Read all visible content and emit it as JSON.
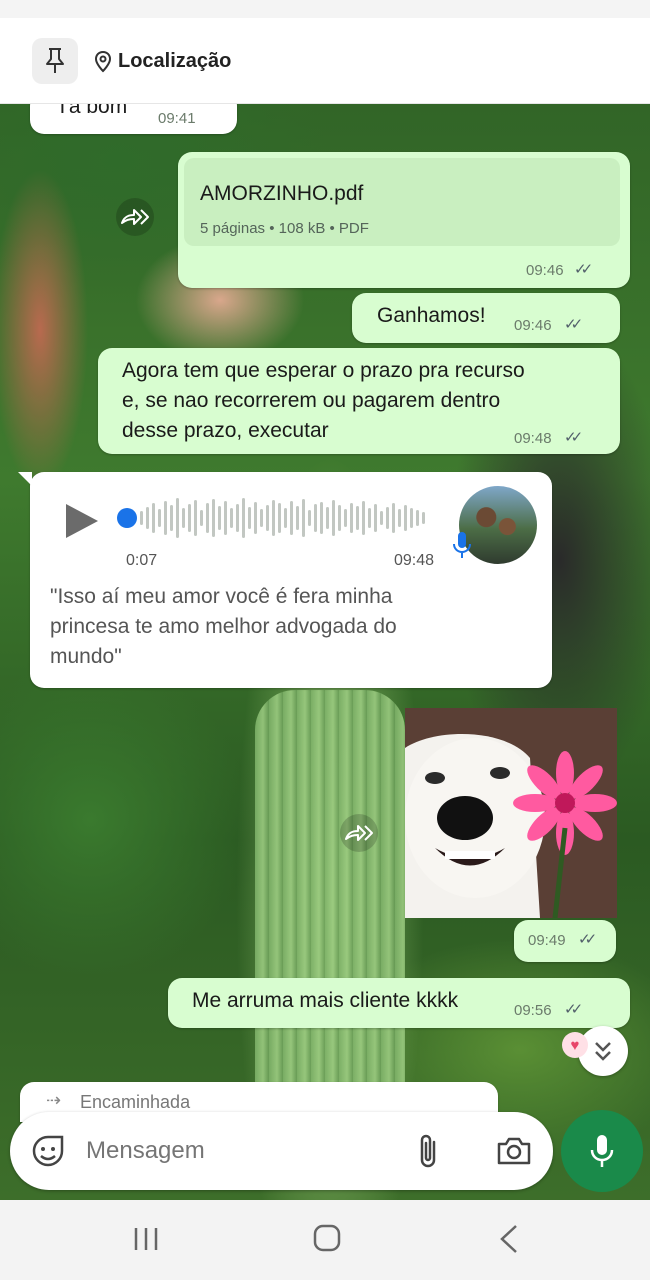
{
  "header": {
    "location_label": "Localização"
  },
  "messages": {
    "m0_text": "Tá bom",
    "m0_time": "09:41",
    "file_name": "AMORZINHO.pdf",
    "file_meta": "5 páginas • 108 kB • PDF",
    "file_time": "09:46",
    "m2_text": "Ganhamos!",
    "m2_time": "09:46",
    "m3_line1": "Agora tem que esperar o prazo pra recurso",
    "m3_line2": "e, se nao recorrerem ou pagarem dentro",
    "m3_line3": "desse prazo, executar",
    "m3_time": "09:48",
    "audio_duration": "0:07",
    "audio_time": "09:48",
    "transcript_line1": "\"Isso aí meu amor você é fera minha",
    "transcript_line2": "princesa te amo melhor advogada do",
    "transcript_line3": "mundo\"",
    "image_time": "09:49",
    "m6_text": "Me arruma mais cliente kkkk",
    "m6_time": "09:56",
    "partial_label": "Encaminhada"
  },
  "input": {
    "placeholder": "Mensagem"
  },
  "colors": {
    "outgoing_bubble": "#d8fdd0",
    "incoming_bubble": "#ffffff",
    "accent_green": "#1a8a4a",
    "audio_dot": "#1a73e8"
  },
  "icons": [
    "pin-icon",
    "location-icon",
    "forward-icon",
    "play-icon",
    "microphone-icon",
    "sticker-icon",
    "attach-icon",
    "camera-icon",
    "scroll-down-icon",
    "recents-icon",
    "home-icon",
    "back-icon"
  ]
}
